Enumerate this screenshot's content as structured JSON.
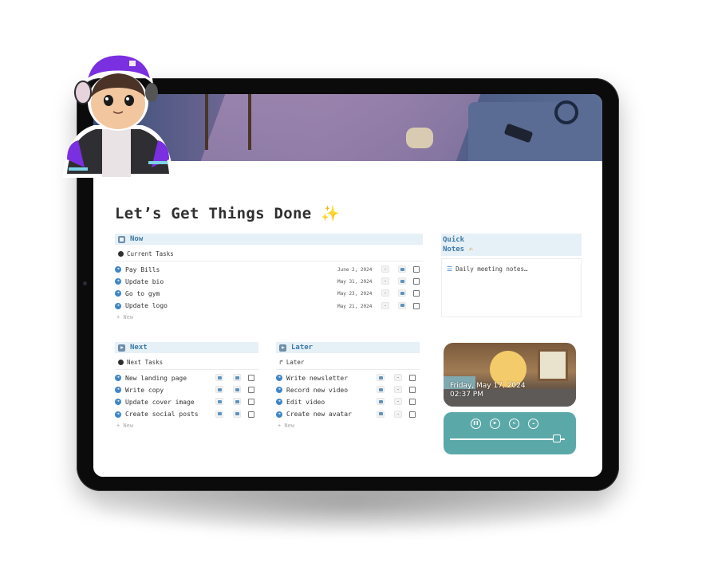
{
  "page": {
    "title": "Let’s Get Things Done",
    "title_emoji": "✨"
  },
  "now": {
    "heading": "Now",
    "view_label": "Current Tasks",
    "tasks": [
      {
        "name": "Pay Bills",
        "date": "June 2, 2024",
        "status": "-",
        "done": false
      },
      {
        "name": "Update bio",
        "date": "May 31, 2024",
        "status": "-",
        "done": false
      },
      {
        "name": "Go to gym",
        "date": "May 23, 2024",
        "status": "-",
        "done": false
      },
      {
        "name": "Update logo",
        "date": "May 21, 2024",
        "status": "-",
        "done": false
      }
    ],
    "new_label": "+ New"
  },
  "next": {
    "heading": "Next",
    "view_label": "Next Tasks",
    "tasks": [
      {
        "name": "New landing page",
        "done": false
      },
      {
        "name": "Write copy",
        "done": false
      },
      {
        "name": "Update cover image",
        "done": false
      },
      {
        "name": "Create social posts",
        "done": false
      }
    ],
    "new_label": "+ New"
  },
  "later": {
    "heading": "Later",
    "view_label": "Later",
    "tasks": [
      {
        "name": "Write newsletter",
        "status": "-",
        "done": false
      },
      {
        "name": "Record new video",
        "status": "-",
        "done": false
      },
      {
        "name": "Edit video",
        "status": "-",
        "done": false
      },
      {
        "name": "Create new avatar",
        "status": "-",
        "done": false
      }
    ],
    "new_label": "+ New"
  },
  "quick_notes": {
    "heading_line1": "Quick",
    "heading_line2": "Notes",
    "heading_emoji": "✍",
    "items": [
      {
        "label": "Daily meeting notes…",
        "icon": "notes-icon"
      }
    ]
  },
  "clock_widget": {
    "date": "Friday, May 17, 2024",
    "time": "02:37 PM"
  },
  "music_player": {
    "controls": [
      "pause-icon",
      "play-icon",
      "replay-icon",
      "rain-sound-icon"
    ],
    "progress": 0.93
  },
  "colors": {
    "section_header_bg": "#e6f0f7",
    "section_header_text": "#3e7aa6",
    "task_arrow": "#3e86c6",
    "player_bg": "#5aa9a8"
  }
}
